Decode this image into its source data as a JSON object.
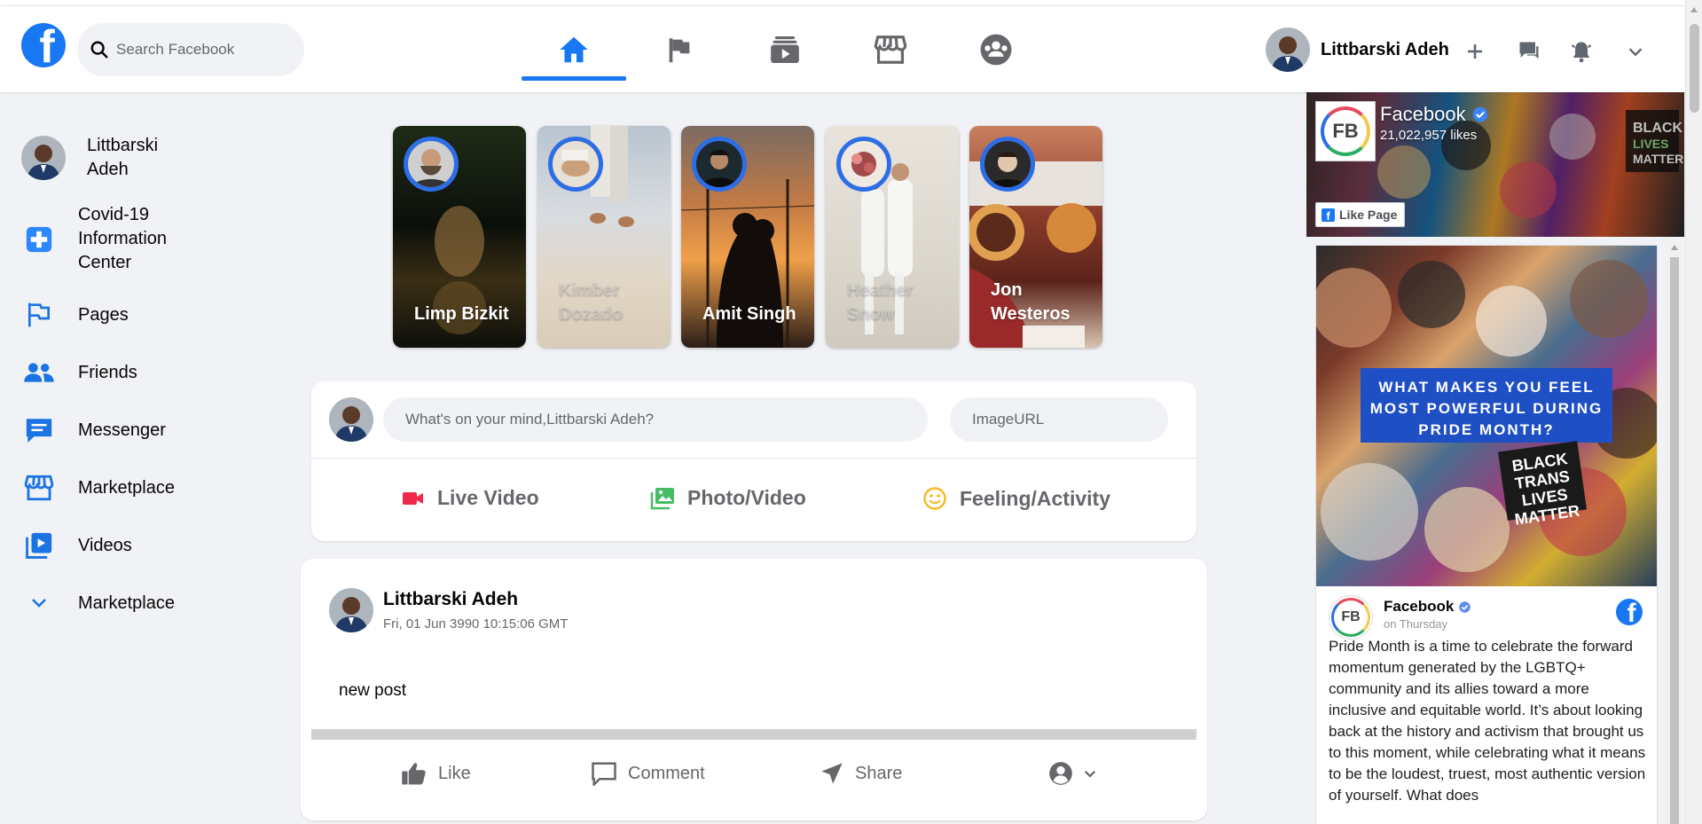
{
  "header": {
    "search_placeholder": "Search Facebook",
    "nav_tabs": [
      "home",
      "pages",
      "watch",
      "marketplace",
      "groups"
    ],
    "profile_name": "Littbarski Adeh",
    "icons": [
      "plus-icon",
      "messenger-icon",
      "notifications-icon",
      "chevron-down-icon"
    ],
    "accent_color": "#1877f2"
  },
  "sidebar": {
    "profile_name": "Littbarski Adeh",
    "items": [
      {
        "label": "Covid-19 Information Center",
        "icon": "covid-info-icon"
      },
      {
        "label": "Pages",
        "icon": "flag-icon"
      },
      {
        "label": "Friends",
        "icon": "friends-icon"
      },
      {
        "label": "Messenger",
        "icon": "messenger-icon"
      },
      {
        "label": "Marketplace",
        "icon": "marketplace-icon"
      },
      {
        "label": "Videos",
        "icon": "video-icon"
      },
      {
        "label": "Marketplace",
        "icon": "chevron-down-icon"
      }
    ]
  },
  "stories": [
    {
      "name": "Limp Bizkit",
      "faded": false
    },
    {
      "name": "Kimber Dozado",
      "faded": true
    },
    {
      "name": "Amit Singh",
      "faded": false
    },
    {
      "name": "Heather Snow",
      "faded": true
    },
    {
      "name": "Jon Westeros",
      "faded": false
    }
  ],
  "composer": {
    "status_placeholder": "What's on your mind,Littbarski Adeh?",
    "image_placeholder": "ImageURL",
    "actions": {
      "live": "Live Video",
      "photo": "Photo/Video",
      "feeling": "Feeling/Activity"
    },
    "action_colors": {
      "live": "#f02849",
      "photo": "#45bd62",
      "feeling": "#f7b928"
    }
  },
  "post": {
    "author": "Littbarski Adeh",
    "timestamp": "Fri, 01 Jun 3990 10:15:06 GMT",
    "text": "new post",
    "actions": {
      "like": "Like",
      "comment": "Comment",
      "share": "Share"
    }
  },
  "page_plugin": {
    "page_name": "Facebook",
    "likes": "21,022,957 likes",
    "like_button": "Like Page",
    "logo_text": "FB",
    "banner_text": "WHAT MAKES YOU FEEL MOST POWERFUL DURING PRIDE MONTH?",
    "sign_text": "BLACK TRANS LIVES MATTER",
    "post_author": "Facebook",
    "post_when": "on Thursday",
    "post_text": "Pride Month is a time to celebrate the forward momentum generated by the LGBTQ+ community and its allies toward a more inclusive and equitable world. It’s about looking back at the history and activism that brought us to this moment, while celebrating what it means to be the loudest, truest, most authentic version of yourself. What does"
  }
}
